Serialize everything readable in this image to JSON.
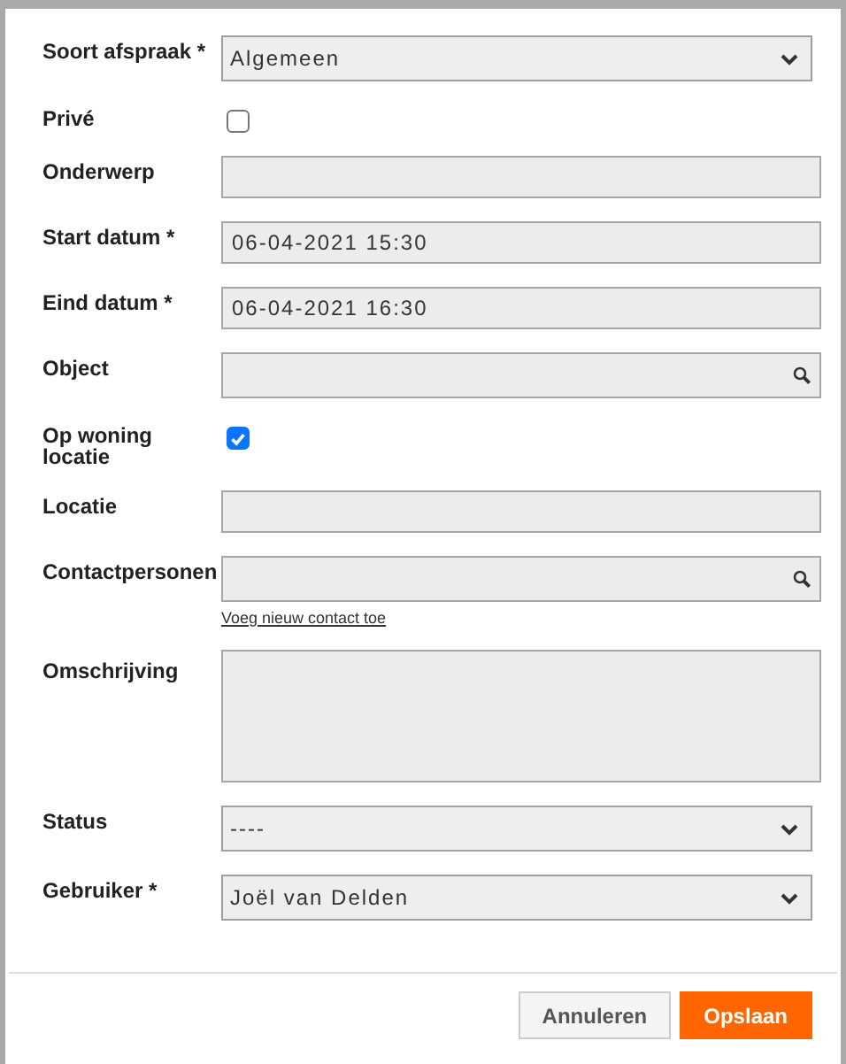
{
  "fields": [
    {
      "kind": "select",
      "label": "Soort afspraak *",
      "value": "Algemeen"
    },
    {
      "kind": "checkbox",
      "label": "Privé",
      "checked": false
    },
    {
      "kind": "text",
      "label": "Onderwerp"
    },
    {
      "kind": "text",
      "label": "Start datum *",
      "value": "06-04-2021 15:30"
    },
    {
      "kind": "text",
      "label": "Eind datum *",
      "value": "06-04-2021 16:30"
    },
    {
      "kind": "search",
      "label": "Object"
    },
    {
      "kind": "checkbox",
      "label": "Op woning locatie",
      "checked": true
    },
    {
      "kind": "text",
      "label": "Locatie"
    },
    {
      "kind": "search",
      "label": "Contactpersonen",
      "link": "Voeg nieuw contact toe"
    },
    {
      "kind": "textarea",
      "label": "Omschrijving"
    },
    {
      "kind": "select",
      "label": "Status",
      "value": "----"
    },
    {
      "kind": "select",
      "label": "Gebruiker *",
      "value": "Joël van Delden"
    }
  ],
  "buttons": [
    {
      "label": "Annuleren",
      "primary": false
    },
    {
      "label": "Opslaan",
      "primary": true
    }
  ]
}
